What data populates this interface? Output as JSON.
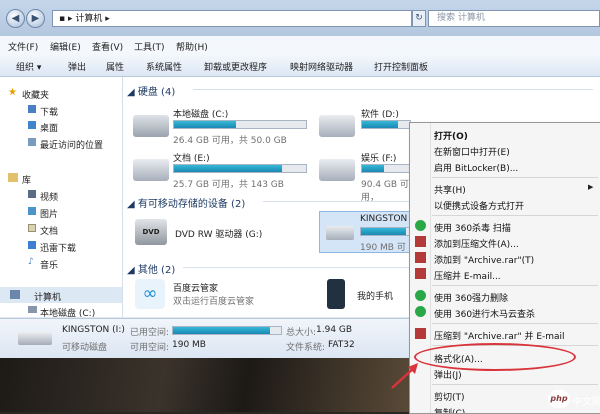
{
  "window": {
    "address": "计算机",
    "search_placeholder": "搜索 计算机"
  },
  "menu": [
    "文件(F)",
    "编辑(E)",
    "查看(V)",
    "工具(T)",
    "帮助(H)"
  ],
  "toolbar": [
    "组织",
    "弹出",
    "属性",
    "系统属性",
    "卸载或更改程序",
    "映射网络驱动器",
    "打开控制面板"
  ],
  "sidebar": {
    "favorites_title": "收藏夹",
    "favorites": [
      "下载",
      "桌面",
      "最近访问的位置"
    ],
    "library_title": "库",
    "libraries": [
      "视频",
      "图片",
      "文档",
      "迅雷下载",
      "音乐"
    ],
    "computer_title": "计算机",
    "computer_items": [
      "本地磁盘 (C:)"
    ]
  },
  "groups": {
    "hdd": "硬盘 (4)",
    "removable": "有可移动存储的设备 (2)",
    "other": "其他 (2)"
  },
  "drives": [
    {
      "name": "本地磁盘 (C:)",
      "free": "26.4 GB 可用，共 50.0 GB",
      "used": 0.47
    },
    {
      "name": "软件 (D:)",
      "free": "",
      "used": 0.75
    },
    {
      "name": "文档 (E:)",
      "free": "25.7 GB 可用，共 143 GB",
      "used": 0.82
    },
    {
      "name": "娱乐 (F:)",
      "free": "90.4 GB 可用，",
      "used": 0.45
    }
  ],
  "removable": [
    {
      "name": "DVD RW 驱动器 (G:)"
    },
    {
      "name": "KINGSTON",
      "free": "190 MB 可",
      "used": 0.9
    }
  ],
  "other": [
    {
      "name": "百度云管家",
      "desc": "双击运行百度云管家"
    },
    {
      "name": "我的手机"
    }
  ],
  "details": {
    "name": "KINGSTON (I:)",
    "type": "可移动磁盘",
    "used_label": "已用空间:",
    "free_label": "可用空间:",
    "free_value": "190 MB",
    "total_label": "总大小:",
    "total_value": "1.94 GB",
    "fs_label": "文件系统:",
    "fs_value": "FAT32",
    "used_fraction": 0.9
  },
  "context_menu": [
    "打开(O)",
    "在新窗口中打开(E)",
    "启用 BitLocker(B)...",
    "共享(H)",
    "以便携式设备方式打开",
    "使用 360杀毒 扫描",
    "添加到压缩文件(A)...",
    "添加到 \"Archive.rar\"(T)",
    "压缩并 E-mail...",
    "使用 360强力删除",
    "使用 360进行木马云查杀",
    "压缩到 \"Archive.rar\" 并 E-mail",
    "格式化(A)...",
    "弹出(J)",
    "剪切(T)",
    "复制(C)"
  ],
  "watermark": "中文网",
  "colors": {
    "accent": "#1a87b3",
    "highlight": "#d8343b"
  }
}
